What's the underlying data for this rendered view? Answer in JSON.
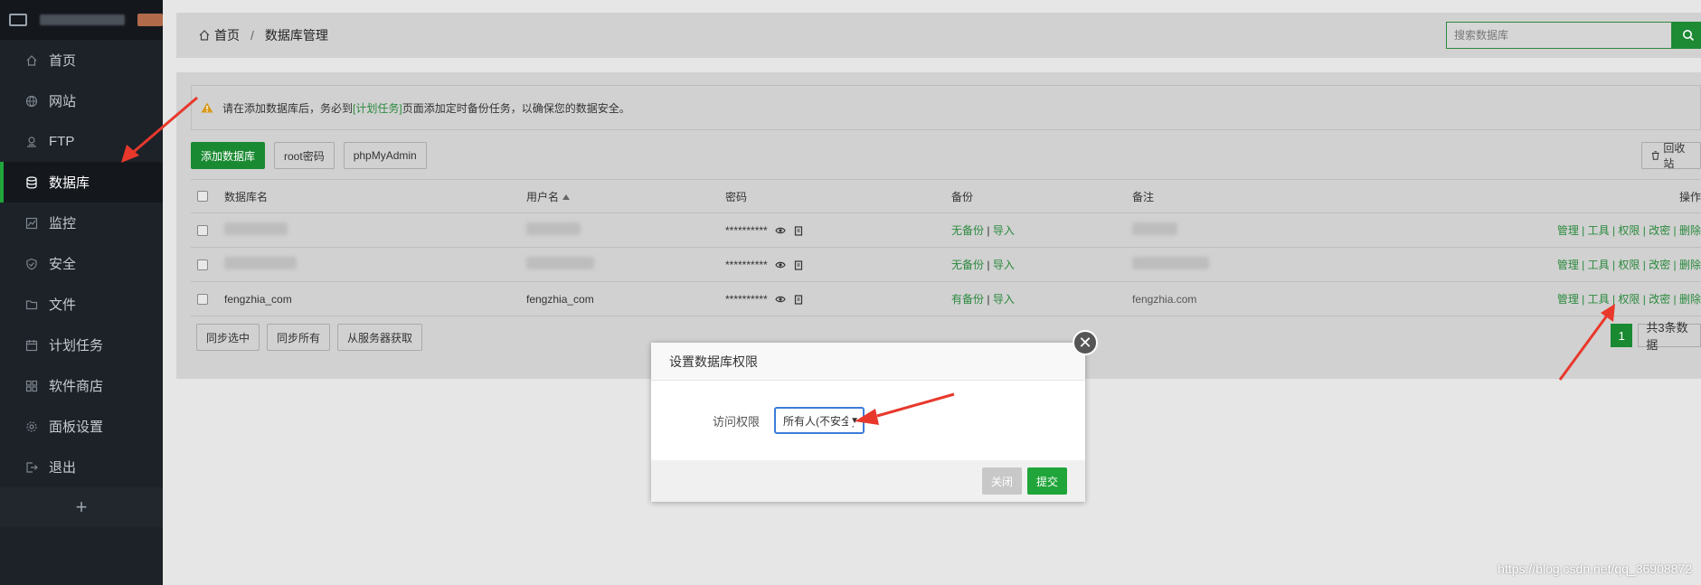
{
  "sidebar": {
    "items": [
      {
        "label": "首页",
        "icon": "home-icon"
      },
      {
        "label": "网站",
        "icon": "globe-icon"
      },
      {
        "label": "FTP",
        "icon": "ftp-icon"
      },
      {
        "label": "数据库",
        "icon": "database-icon",
        "active": true
      },
      {
        "label": "监控",
        "icon": "monitor-icon"
      },
      {
        "label": "安全",
        "icon": "shield-icon"
      },
      {
        "label": "文件",
        "icon": "folder-icon"
      },
      {
        "label": "计划任务",
        "icon": "calendar-icon"
      },
      {
        "label": "软件商店",
        "icon": "grid-icon"
      },
      {
        "label": "面板设置",
        "icon": "gear-icon"
      },
      {
        "label": "退出",
        "icon": "logout-icon"
      }
    ],
    "add_label": "+"
  },
  "breadcrumb": {
    "home": "首页",
    "sep": "/",
    "current": "数据库管理"
  },
  "search": {
    "placeholder": "搜索数据库"
  },
  "notice": {
    "before": "请在添加数据库后，务必到",
    "link": "[计划任务]",
    "after": "页面添加定时备份任务，以确保您的数据安全。"
  },
  "toolbar": {
    "add": "添加数据库",
    "root": "root密码",
    "pma": "phpMyAdmin",
    "recycle": "回收站"
  },
  "table": {
    "headers": {
      "name": "数据库名",
      "user": "用户名",
      "pass": "密码",
      "backup": "备份",
      "note": "备注",
      "ops": "操作"
    },
    "rows": [
      {
        "name": "",
        "user": "",
        "pass": "**********",
        "backup": "无备份",
        "import": "导入",
        "note": ""
      },
      {
        "name": "",
        "user": "",
        "pass": "**********",
        "backup": "无备份",
        "import": "导入",
        "note": ""
      },
      {
        "name": "fengzhia_com",
        "user": "fengzhia_com",
        "pass": "**********",
        "backup": "有备份",
        "import": "导入",
        "note": "fengzhia.com"
      }
    ],
    "ops": "管理 | 工具 | 权限 | 改密 | 删除",
    "bak_sep": "|"
  },
  "bottom": {
    "sync_sel": "同步选中",
    "sync_all": "同步所有",
    "fetch": "从服务器获取"
  },
  "pager": {
    "current": "1",
    "total": "共3条数据"
  },
  "modal": {
    "title": "设置数据库权限",
    "label": "访问权限",
    "select_value": "所有人(不安全)",
    "close": "关闭",
    "submit": "提交"
  },
  "watermark": "https://blog.csdn.net/qq_36908872",
  "colors": {
    "accent": "#20a53a",
    "sidebar": "#1d2229",
    "arrow": "#e8382c"
  }
}
